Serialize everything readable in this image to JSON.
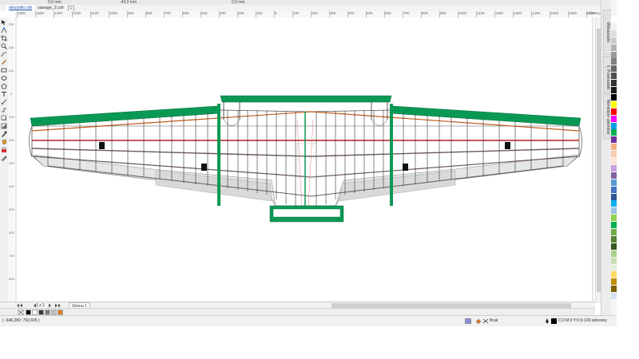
{
  "toolbar": {
    "x_value": "0,0 mm",
    "y_value": "-42,0 mm",
    "z_value": "0,0 mm"
  },
  "tabs": [
    {
      "label": "skrzydlo.cdr",
      "active": true
    },
    {
      "label": "savage_2.cdr",
      "active": false
    }
  ],
  "new_tab_label": "+",
  "hruler": {
    "ticks": [
      "1800",
      "1600",
      "1400",
      "1200",
      "1100",
      "1000",
      "900",
      "800",
      "700",
      "600",
      "400",
      "300",
      "200",
      "100",
      "0",
      "100",
      "200",
      "300",
      "400",
      "500",
      "600",
      "700",
      "800",
      "900",
      "1000",
      "1100",
      "1200",
      "1300",
      "1400",
      "1500",
      "1600",
      "1700"
    ],
    "unit": "milimetry"
  },
  "vruler": {
    "ticks": [
      "300",
      "200",
      "100",
      "0",
      "-100",
      "-200",
      "-300",
      "-400",
      "-500",
      "-600",
      "-700",
      "-800"
    ]
  },
  "dock": {
    "tabs": [
      "Wskazówki",
      "Właściwości",
      "Przekształć",
      "Menedżer obiektów"
    ]
  },
  "palette_colors": [
    "#ffffff",
    "#f2f2f2",
    "#e0e0e0",
    "#cccccc",
    "#b3b3b3",
    "#999999",
    "#808080",
    "#666666",
    "#4d4d4d",
    "#333333",
    "#1a1a1a",
    "#000000",
    "#ffff00",
    "#ff0000",
    "#ff00ff",
    "#00a0e9",
    "#00b050",
    "#7030a0",
    "#f4b183",
    "#f8cbad",
    "#fce4d6",
    "#c9a0dc",
    "#8064a2",
    "#5b9bd5",
    "#4472c4",
    "#2f5597",
    "#00b0f0",
    "#9bc2e6",
    "#92d050",
    "#00b050",
    "#70ad47",
    "#548235",
    "#385723",
    "#a9d08e",
    "#c6e0b4",
    "#e2efda",
    "#ffd966",
    "#bf8f00",
    "#806000",
    "#d9e1f2"
  ],
  "pagebar": {
    "page_count": "1 z 1",
    "page_tab": "Strona 1"
  },
  "docpal_colors": [
    "#000000",
    "#ffffff",
    "#3a3a3a",
    "#7f7f7f",
    "#c0c0c0",
    "#e07b1a"
  ],
  "status": {
    "coords": "( -648,280; 792,605 )",
    "fill_label": "Brak",
    "outline_label": "C:0 M:0 Y:0 K:100  włosowy"
  }
}
